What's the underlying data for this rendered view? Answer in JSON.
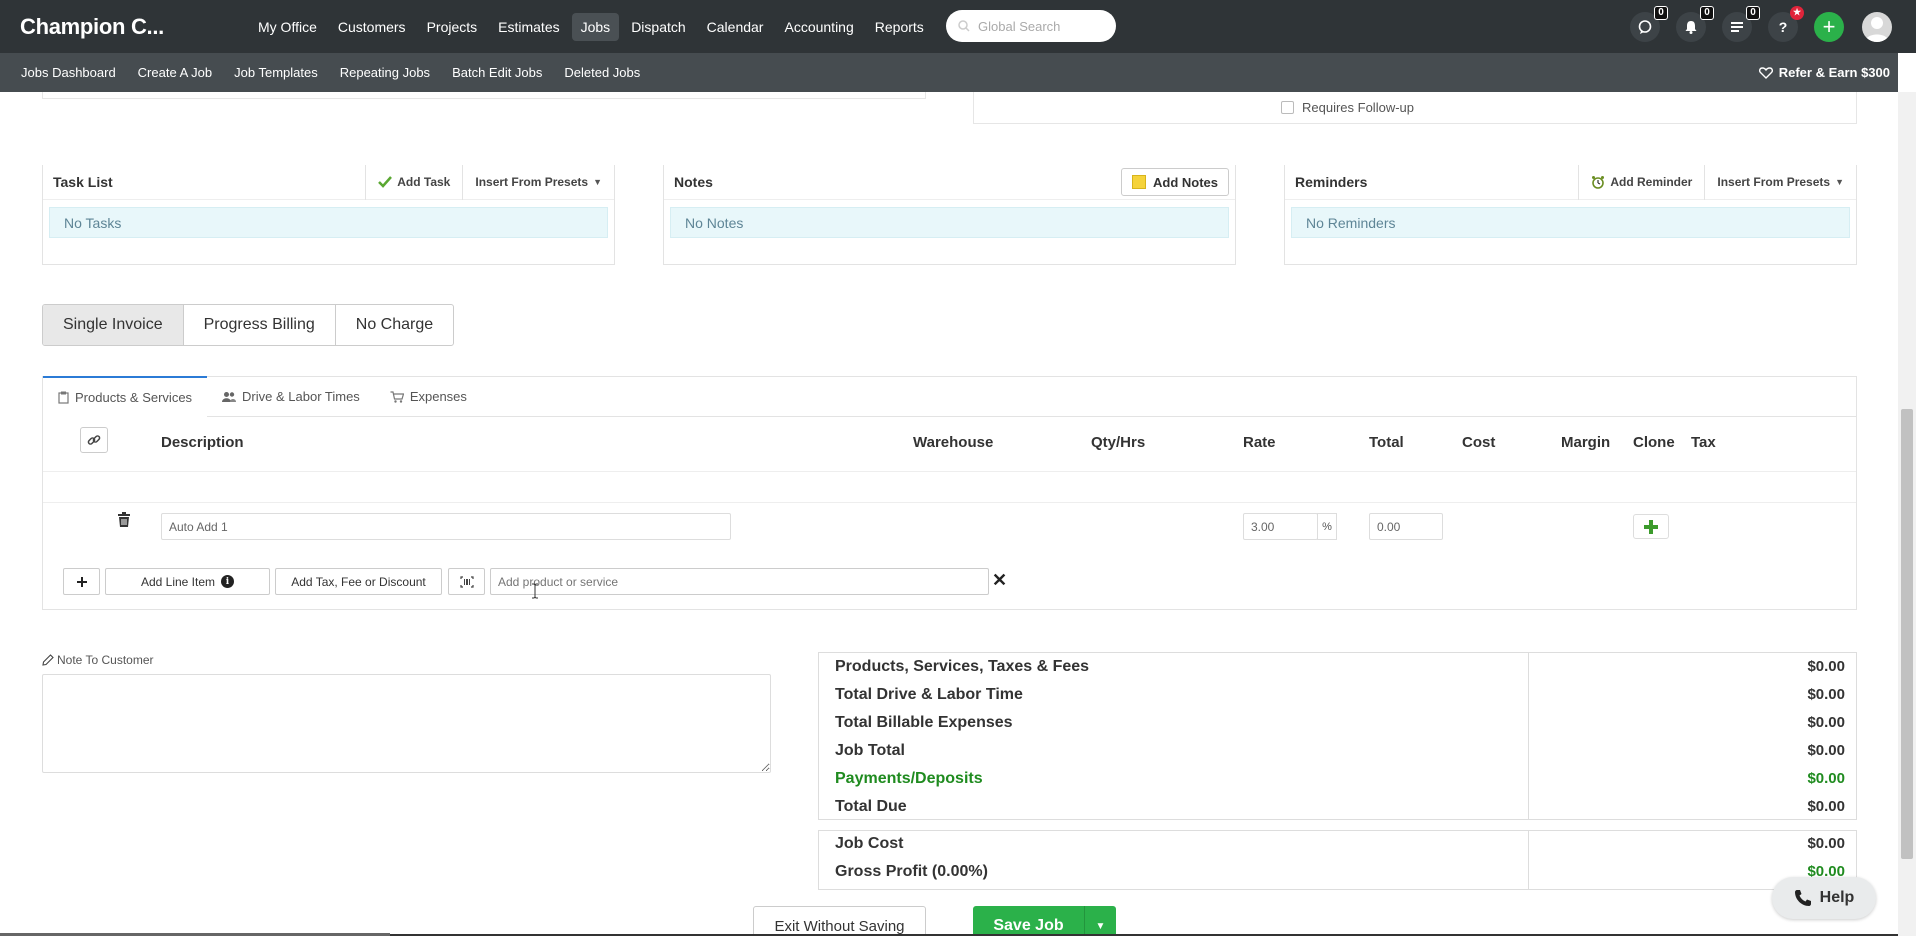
{
  "app": {
    "brand": "Champion C...",
    "nav": [
      "My Office",
      "Customers",
      "Projects",
      "Estimates",
      "Jobs",
      "Dispatch",
      "Calendar",
      "Accounting",
      "Reports"
    ],
    "active_nav": "Jobs",
    "search_placeholder": "Global Search",
    "badges": {
      "chat": "0",
      "notifications": "0",
      "tasks": "0"
    },
    "help_glyph": "?",
    "add_glyph": "+"
  },
  "subnav": {
    "items": [
      "Jobs Dashboard",
      "Create A Job",
      "Job Templates",
      "Repeating Jobs",
      "Batch Edit Jobs",
      "Deleted Jobs"
    ],
    "refer": "Refer & Earn $300"
  },
  "followup": {
    "label": "Requires Follow-up"
  },
  "panels": {
    "tasks": {
      "title": "Task List",
      "add": "Add Task",
      "presets": "Insert From Presets",
      "empty": "No Tasks"
    },
    "notes": {
      "title": "Notes",
      "add": "Add Notes",
      "empty": "No Notes"
    },
    "reminders": {
      "title": "Reminders",
      "add": "Add Reminder",
      "presets": "Insert From Presets",
      "empty": "No Reminders"
    }
  },
  "billing": {
    "options": [
      "Single Invoice",
      "Progress Billing",
      "No Charge"
    ],
    "active": "Single Invoice"
  },
  "items": {
    "tabs": [
      "Products & Services",
      "Drive & Labor Times",
      "Expenses"
    ],
    "columns": [
      "Description",
      "Warehouse",
      "Qty/Hrs",
      "Rate",
      "Total",
      "Cost",
      "Margin",
      "Clone",
      "Tax"
    ],
    "row": {
      "description": "Auto Add 1",
      "rate": "3.00",
      "rate_unit": "%",
      "total": "0.00"
    },
    "add_line": "Add Line Item",
    "add_tax": "Add Tax, Fee or Discount",
    "add_product_placeholder": "Add product or service",
    "close_glyph": "✕"
  },
  "note": {
    "label": "Note To Customer"
  },
  "totals": [
    {
      "label": "Products, Services, Taxes & Fees",
      "amount": "$0.00"
    },
    {
      "label": "Total Drive & Labor Time",
      "amount": "$0.00"
    },
    {
      "label": "Total Billable Expenses",
      "amount": "$0.00"
    },
    {
      "label": "Job Total",
      "amount": "$0.00"
    },
    {
      "label": "Payments/Deposits",
      "amount": "$0.00"
    },
    {
      "label": "Total Due",
      "amount": "$0.00"
    }
  ],
  "totals2": [
    {
      "label": "Job Cost",
      "amount": "$0.00"
    },
    {
      "label": "Gross Profit (0.00%)",
      "amount": "$0.00"
    }
  ],
  "actions": {
    "exit": "Exit Without Saving",
    "save": "Save Job",
    "help": "Help"
  },
  "colors": {
    "accent": "#2bb14a",
    "topbar": "#2f3437",
    "subbar": "#464c50",
    "green_text": "#1f8b1f"
  }
}
